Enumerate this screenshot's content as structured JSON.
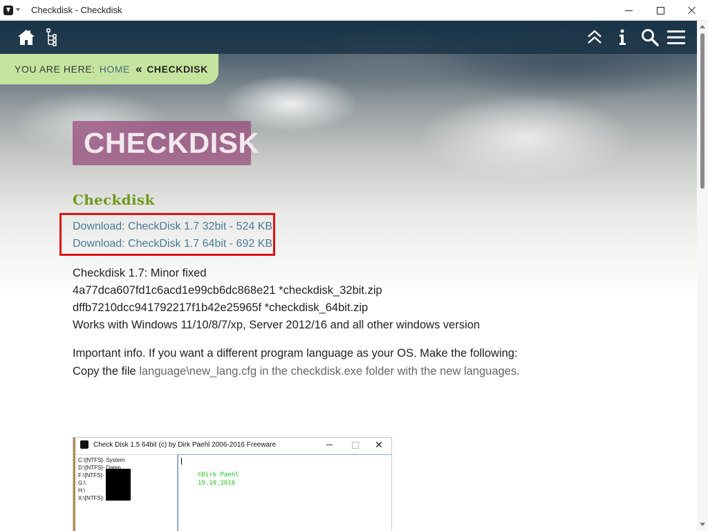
{
  "window": {
    "title": "Checkdisk - Checkdisk"
  },
  "nav": {
    "left_icons": [
      "home-icon",
      "sitemap-icon"
    ],
    "right_icons": [
      "chevrons-up-icon",
      "info-icon",
      "search-icon",
      "hamburger-menu-icon"
    ]
  },
  "breadcrumb": {
    "prefix": "YOU ARE HERE:",
    "home": "HOME",
    "separator": "«",
    "current": "CHECKDISK"
  },
  "page": {
    "title": "CHECKDISK",
    "subheading": "Checkdisk",
    "downloads": [
      "Download: CheckDisk 1.7 32bit - 524 KB",
      "Download: CheckDisk 1.7 64bit - 692 KB"
    ],
    "info_lines": [
      "Checkdisk 1.7: Minor fixed",
      "4a77dca607fd1c6acd1e99cb6dc868e21 *checkdisk_32bit.zip",
      "dffb7210dcc941792217f1b42e25965f *checkdisk_64bit.zip",
      "Works with Windows 11/10/8/7/xp, Server 2012/16 and all other windows version"
    ],
    "important": "Important info. If you want a different program language as your OS. Make the following:",
    "copy_prefix": "Copy the file",
    "copy_rest": "language\\new_lang.cfg in the checkdisk.exe folder with the new languages."
  },
  "screenshot": {
    "title": "Check Disk 1.5 64bit (c) by Dirk Paehl  2006-2016 Freeware",
    "close_glyph": "✕",
    "drives": [
      "C:\\[NTFS]- System",
      "D:\\[NTFS]- Daten",
      "F:\\[NTFS]-",
      "G:\\",
      "H:\\",
      "X:\\[NTFS]-"
    ],
    "console_lines": [
      "©Dirk Paehl",
      "19.10.2016"
    ],
    "console_color": "#19c419"
  },
  "colors": {
    "accent_green": "#6f9a1e",
    "link": "#4a7896",
    "breadcrumb_bg": "#c5e4a0",
    "title_box": "#964678",
    "highlight_border": "#e01010"
  }
}
